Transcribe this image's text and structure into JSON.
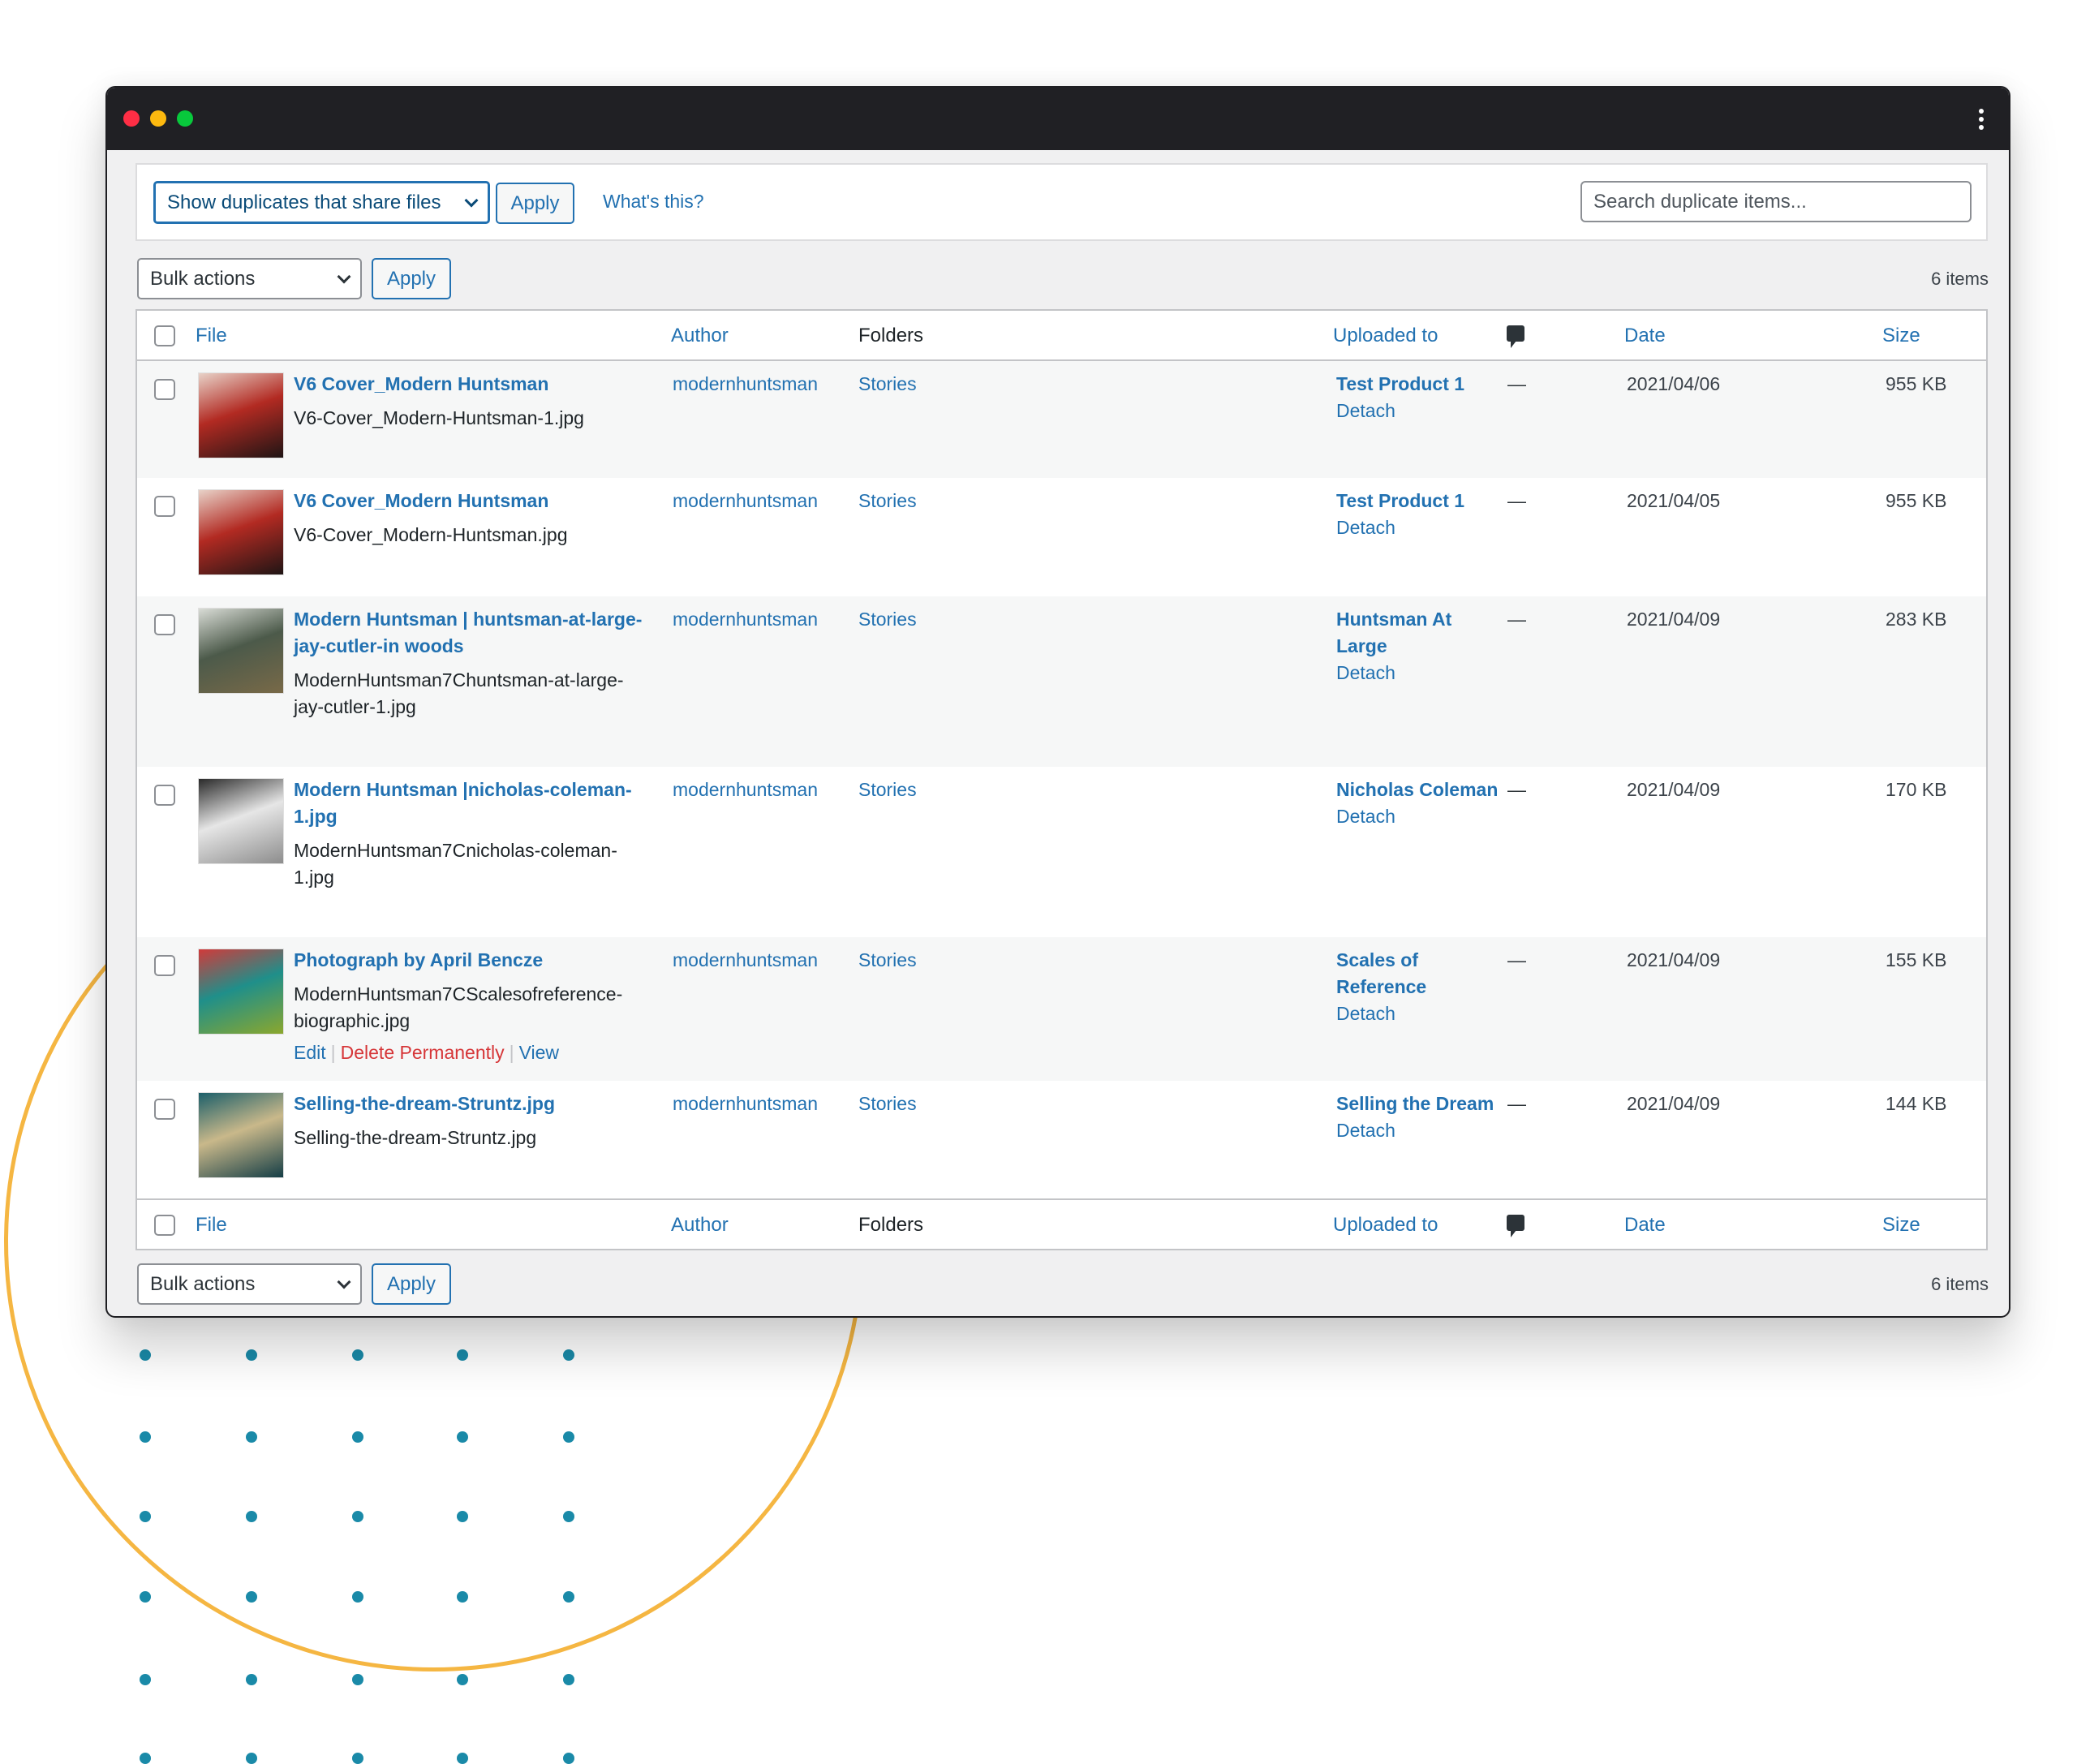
{
  "window": {
    "controls": [
      "close",
      "minimize",
      "maximize"
    ],
    "menu_icon": "kebab-menu-icon"
  },
  "filter": {
    "view_select": "Show duplicates that share files",
    "apply_label": "Apply",
    "help_link": "What's this?",
    "search_placeholder": "Search duplicate items..."
  },
  "top_nav": {
    "bulk_actions": "Bulk actions",
    "apply_label": "Apply",
    "count": "6 items"
  },
  "bottom_nav": {
    "bulk_actions": "Bulk actions",
    "apply_label": "Apply",
    "count": "6 items"
  },
  "columns": {
    "file": "File",
    "author": "Author",
    "folders": "Folders",
    "uploaded_to": "Uploaded to",
    "comments_icon": "comment-bubble-icon",
    "date": "Date",
    "size": "Size"
  },
  "rows": [
    {
      "title": "V6 Cover_Modern Huntsman",
      "filename": "V6-Cover_Modern-Huntsman-1.jpg",
      "author": "modernhuntsman",
      "folder": "Stories",
      "uploaded_to": "Test Product 1",
      "detach": "Detach",
      "comments": "—",
      "date": "2021/04/06",
      "size": "955 KB",
      "thumb_colors": [
        "#b22a22",
        "#e8d2c8",
        "#1a1414"
      ]
    },
    {
      "title": "V6 Cover_Modern Huntsman",
      "filename": "V6-Cover_Modern-Huntsman.jpg",
      "author": "modernhuntsman",
      "folder": "Stories",
      "uploaded_to": "Test Product 1",
      "detach": "Detach",
      "comments": "—",
      "date": "2021/04/05",
      "size": "955 KB",
      "thumb_colors": [
        "#b22a22",
        "#e8d2c8",
        "#1a1414"
      ]
    },
    {
      "title": "Modern Huntsman | huntsman-at-large-jay-cutler-in woods",
      "filename": "ModernHuntsman7Chuntsman-at-large-jay-cutler-1.jpg",
      "author": "modernhuntsman",
      "folder": "Stories",
      "uploaded_to": "Huntsman At Large",
      "detach": "Detach",
      "comments": "—",
      "date": "2021/04/09",
      "size": "283 KB",
      "thumb_colors": [
        "#4c5a4a",
        "#d9dcd6",
        "#7a6a48"
      ]
    },
    {
      "title": "Modern Huntsman |nicholas-coleman-1.jpg",
      "filename": "ModernHuntsman7Cnicholas-coleman-1.jpg",
      "author": "modernhuntsman",
      "folder": "Stories",
      "uploaded_to": "Nicholas Coleman",
      "detach": "Detach",
      "comments": "—",
      "date": "2021/04/09",
      "size": "170 KB",
      "thumb_colors": [
        "#e6e6e6",
        "#2a2a2a",
        "#8a8a8a"
      ]
    },
    {
      "title": "Photograph by April Bencze",
      "filename": "ModernHuntsman7CScalesofreference-biographic.jpg",
      "author": "modernhuntsman",
      "folder": "Stories",
      "uploaded_to": "Scales of Reference",
      "detach": "Detach",
      "comments": "—",
      "date": "2021/04/09",
      "size": "155 KB",
      "thumb_colors": [
        "#1f8f8a",
        "#d13a3a",
        "#8fa82a"
      ],
      "row_actions": {
        "edit": "Edit",
        "delete": "Delete Permanently",
        "view": "View"
      }
    },
    {
      "title": "Selling-the-dream-Struntz.jpg",
      "filename": "Selling-the-dream-Struntz.jpg",
      "author": "modernhuntsman",
      "folder": "Stories",
      "uploaded_to": "Selling the Dream",
      "detach": "Detach",
      "comments": "—",
      "date": "2021/04/09",
      "size": "144 KB",
      "thumb_colors": [
        "#c9b88a",
        "#1c5f6a",
        "#0f3a44"
      ]
    }
  ],
  "colors": {
    "link": "#2271b1",
    "danger": "#d63638",
    "titlebar": "#202024",
    "accent_circle": "#f5b642",
    "dots": "#1a8aa8"
  }
}
